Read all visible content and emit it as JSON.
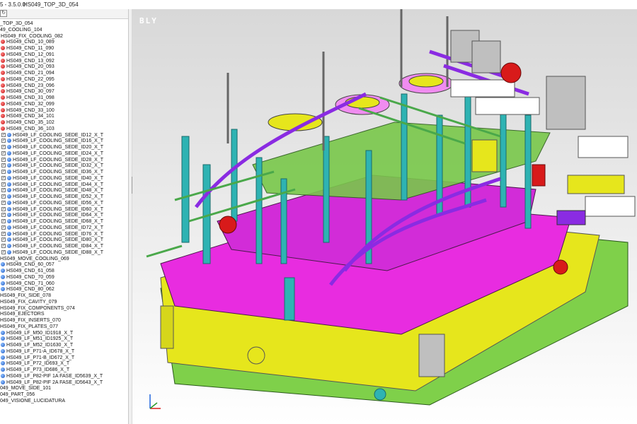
{
  "window": {
    "title_prefix": "5 - 3.5.0.0",
    "document_name": "HS049_TOP_3D_054"
  },
  "viewport": {
    "watermark": "BLY"
  },
  "colors": {
    "magenta": "#e82ce0",
    "yellow": "#e6e61c",
    "green": "#7fd04a",
    "teal": "#2eb3b3",
    "purple": "#8a2be2",
    "red": "#d81a1a",
    "grey_block": "#bfbfbf"
  },
  "tree": {
    "rows": [
      {
        "text": "_TOP_3D_054",
        "indent": 0,
        "check": false,
        "icon": "none"
      },
      {
        "text": "49_COOLING_104",
        "indent": 0,
        "check": false,
        "icon": "none"
      },
      {
        "text": "HS049_FIX_COOLING_082",
        "indent": 1,
        "check": false,
        "icon": "none"
      },
      {
        "text": "HS049_CND_10_089",
        "indent": 1,
        "check": false,
        "icon": "red"
      },
      {
        "text": "HS049_CND_11_090",
        "indent": 1,
        "check": false,
        "icon": "red"
      },
      {
        "text": "HS049_CND_12_091",
        "indent": 1,
        "check": false,
        "icon": "red"
      },
      {
        "text": "HS049_CND_13_092",
        "indent": 1,
        "check": false,
        "icon": "red"
      },
      {
        "text": "HS049_CND_20_093",
        "indent": 1,
        "check": false,
        "icon": "red"
      },
      {
        "text": "HS049_CND_21_094",
        "indent": 1,
        "check": false,
        "icon": "red"
      },
      {
        "text": "HS049_CND_22_095",
        "indent": 1,
        "check": false,
        "icon": "red"
      },
      {
        "text": "HS049_CND_23_096",
        "indent": 1,
        "check": false,
        "icon": "red"
      },
      {
        "text": "HS049_CND_30_097",
        "indent": 1,
        "check": false,
        "icon": "red"
      },
      {
        "text": "HS049_CND_31_098",
        "indent": 1,
        "check": false,
        "icon": "red"
      },
      {
        "text": "HS049_CND_32_099",
        "indent": 1,
        "check": false,
        "icon": "red"
      },
      {
        "text": "HS049_CND_33_100",
        "indent": 1,
        "check": false,
        "icon": "red"
      },
      {
        "text": "HS049_CND_34_101",
        "indent": 1,
        "check": false,
        "icon": "red"
      },
      {
        "text": "HS049_CND_35_102",
        "indent": 1,
        "check": false,
        "icon": "red"
      },
      {
        "text": "HS049_CND_36_103",
        "indent": 1,
        "check": false,
        "icon": "red"
      },
      {
        "text": "HS049_LF_COOLING_SEDE_ID12_X_T",
        "indent": 2,
        "check": true,
        "icon": "blue"
      },
      {
        "text": "HS049_LF_COOLING_SEDE_ID16_X_T",
        "indent": 2,
        "check": true,
        "icon": "blue"
      },
      {
        "text": "HS049_LF_COOLING_SEDE_ID20_X_T",
        "indent": 2,
        "check": true,
        "icon": "blue"
      },
      {
        "text": "HS049_LF_COOLING_SEDE_ID24_X_T",
        "indent": 2,
        "check": true,
        "icon": "blue"
      },
      {
        "text": "HS049_LF_COOLING_SEDE_ID28_X_T",
        "indent": 2,
        "check": true,
        "icon": "blue"
      },
      {
        "text": "HS049_LF_COOLING_SEDE_ID32_X_T",
        "indent": 2,
        "check": true,
        "icon": "blue"
      },
      {
        "text": "HS049_LF_COOLING_SEDE_ID36_X_T",
        "indent": 2,
        "check": true,
        "icon": "blue"
      },
      {
        "text": "HS049_LF_COOLING_SEDE_ID40_X_T",
        "indent": 2,
        "check": true,
        "icon": "blue"
      },
      {
        "text": "HS049_LF_COOLING_SEDE_ID44_X_T",
        "indent": 2,
        "check": true,
        "icon": "blue"
      },
      {
        "text": "HS049_LF_COOLING_SEDE_ID48_X_T",
        "indent": 2,
        "check": true,
        "icon": "blue"
      },
      {
        "text": "HS049_LF_COOLING_SEDE_ID52_X_T",
        "indent": 2,
        "check": true,
        "icon": "blue"
      },
      {
        "text": "HS049_LF_COOLING_SEDE_ID56_X_T",
        "indent": 2,
        "check": true,
        "icon": "blue"
      },
      {
        "text": "HS049_LF_COOLING_SEDE_ID60_X_T",
        "indent": 2,
        "check": true,
        "icon": "blue"
      },
      {
        "text": "HS049_LF_COOLING_SEDE_ID64_X_T",
        "indent": 2,
        "check": true,
        "icon": "blue"
      },
      {
        "text": "HS049_LF_COOLING_SEDE_ID68_X_T",
        "indent": 2,
        "check": true,
        "icon": "blue"
      },
      {
        "text": "HS049_LF_COOLING_SEDE_ID72_X_T",
        "indent": 2,
        "check": true,
        "icon": "blue"
      },
      {
        "text": "HS049_LF_COOLING_SEDE_ID76_X_T",
        "indent": 2,
        "check": true,
        "icon": "blue"
      },
      {
        "text": "HS049_LF_COOLING_SEDE_ID80_X_T",
        "indent": 2,
        "check": true,
        "icon": "blue"
      },
      {
        "text": "HS049_LF_COOLING_SEDE_ID84_X_T",
        "indent": 2,
        "check": true,
        "icon": "blue"
      },
      {
        "text": "HS049_LF_COOLING_SEDE_ID88_X_T",
        "indent": 2,
        "check": true,
        "icon": "blue"
      },
      {
        "text": "HS049_MOVE_COOLING_069",
        "indent": 0,
        "check": false,
        "icon": "none"
      },
      {
        "text": "HS049_CND_60_057",
        "indent": 1,
        "check": false,
        "icon": "blue"
      },
      {
        "text": "HS049_CND_61_058",
        "indent": 1,
        "check": false,
        "icon": "blue"
      },
      {
        "text": "HS049_CND_70_059",
        "indent": 1,
        "check": false,
        "icon": "blue"
      },
      {
        "text": "HS049_CND_71_060",
        "indent": 1,
        "check": false,
        "icon": "blue"
      },
      {
        "text": "HS049_CND_80_062",
        "indent": 1,
        "check": false,
        "icon": "blue"
      },
      {
        "text": "HS049_FIX_SIDE_078",
        "indent": 0,
        "check": false,
        "icon": "none"
      },
      {
        "text": "HS049_FIX_CAVITY_079",
        "indent": 0,
        "check": false,
        "icon": "none"
      },
      {
        "text": "HS049_FIX_COMPONENTS_074",
        "indent": 0,
        "check": false,
        "icon": "none"
      },
      {
        "text": "HS049_EJECTORS",
        "indent": 0,
        "check": false,
        "icon": "none"
      },
      {
        "text": "HS049_FIX_INSERTS_070",
        "indent": 0,
        "check": false,
        "icon": "none"
      },
      {
        "text": "HS049_FIX_PLATES_077",
        "indent": 0,
        "check": false,
        "icon": "none"
      },
      {
        "text": "HS049_LF_M50_ID1918_X_T",
        "indent": 1,
        "check": false,
        "icon": "blue"
      },
      {
        "text": "HS049_LF_M51_ID1925_X_T",
        "indent": 1,
        "check": false,
        "icon": "blue"
      },
      {
        "text": "HS049_LF_M52_ID1630_X_T",
        "indent": 1,
        "check": false,
        "icon": "blue"
      },
      {
        "text": "HS049_LF_P71-A_ID678_X_T",
        "indent": 1,
        "check": false,
        "icon": "blue"
      },
      {
        "text": "HS049_LF_P71-B_ID672_X_T",
        "indent": 1,
        "check": false,
        "icon": "blue"
      },
      {
        "text": "HS049_LF_P72_ID693_X_T",
        "indent": 1,
        "check": false,
        "icon": "blue"
      },
      {
        "text": "HS049_LF_P73_ID686_X_T",
        "indent": 1,
        "check": false,
        "icon": "blue"
      },
      {
        "text": "HS049_LF_P82-PIF 1A FASE_ID5639_X_T",
        "indent": 1,
        "check": false,
        "icon": "blue"
      },
      {
        "text": "HS049_LF_P82-PIF 2A FASE_ID5643_X_T",
        "indent": 1,
        "check": false,
        "icon": "blue"
      },
      {
        "text": "049_MOVE_SIDE_101",
        "indent": 0,
        "check": false,
        "icon": "none"
      },
      {
        "text": "049_PART_056",
        "indent": 0,
        "check": false,
        "icon": "none"
      },
      {
        "text": "049_VISIONE_LUCIDATURA",
        "indent": 0,
        "check": false,
        "icon": "none"
      }
    ]
  }
}
